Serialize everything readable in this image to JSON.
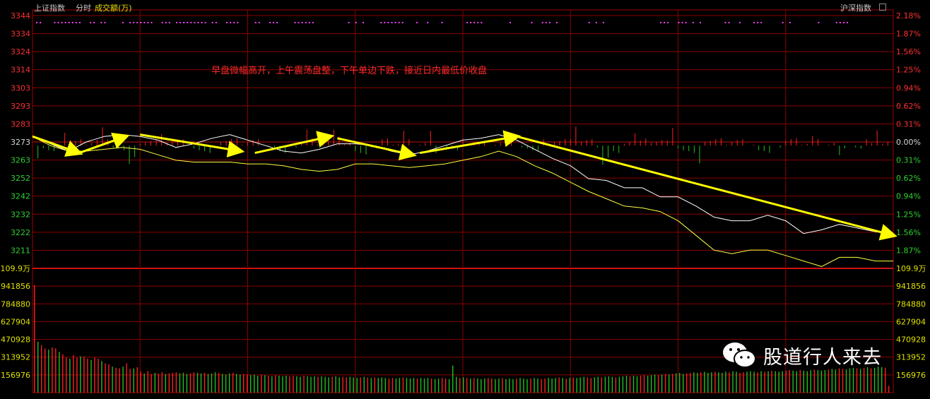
{
  "header": {
    "index_name": "上证指数",
    "period": "分时",
    "indicator": "成交额(万)",
    "right_label": "沪深指数"
  },
  "annotation": "早盘微幅高开，上午震荡盘整，下午单边下跌，接近日内最低价收盘",
  "watermark": {
    "text": "股道行人来去",
    "icon": "wechat-icon"
  },
  "colors": {
    "up": "#ff2020",
    "down": "#20c020",
    "price": "#ffffff",
    "avg": "#ffff40",
    "grid": "#8b0000",
    "arrow": "#ffff00"
  },
  "chart_data": [
    {
      "type": "line",
      "title": "",
      "y_left_ticks": [
        "3344",
        "3334",
        "3324",
        "3314",
        "3303",
        "3293",
        "3283",
        "3273",
        "3263",
        "3252",
        "3242",
        "3232",
        "3222",
        "3211"
      ],
      "y_right_ticks": [
        "2.18%",
        "1.87%",
        "1.56%",
        "1.25%",
        "0.94%",
        "0.62%",
        "0.31%",
        "0.00%",
        "0.31%",
        "0.62%",
        "0.94%",
        "1.25%",
        "1.56%",
        "1.87%"
      ],
      "ylim": [
        3206,
        3344
      ],
      "prev_close": 3273,
      "x_minutes": [
        0,
        5,
        10,
        15,
        20,
        25,
        30,
        35,
        40,
        45,
        50,
        55,
        60,
        65,
        70,
        75,
        80,
        85,
        90,
        95,
        100,
        105,
        110,
        115,
        120,
        125,
        130,
        135,
        140,
        145,
        150,
        155,
        160,
        165,
        170,
        175,
        180,
        185,
        190,
        195,
        200,
        205,
        210,
        215,
        220,
        225,
        230,
        235,
        240
      ],
      "series": [
        {
          "values": [
            3278,
            3274,
            3270,
            3275,
            3278,
            3279,
            3278,
            3276,
            3272,
            3274,
            3277,
            3279,
            3276,
            3273,
            3270,
            3269,
            3271,
            3274,
            3274,
            3273,
            3270,
            3268,
            3270,
            3273,
            3276,
            3277,
            3279,
            3276,
            3271,
            3266,
            3262,
            3255,
            3254,
            3250,
            3250,
            3245,
            3245,
            3240,
            3234,
            3232,
            3232,
            3235,
            3232,
            3225,
            3227,
            3230,
            3228,
            3226,
            3225
          ]
        },
        {
          "values": [
            3278,
            3273,
            3270,
            3270,
            3271,
            3272,
            3271,
            3268,
            3265,
            3264,
            3264,
            3264,
            3263,
            3263,
            3262,
            3260,
            3259,
            3260,
            3263,
            3263,
            3262,
            3261,
            3262,
            3263,
            3265,
            3267,
            3270,
            3267,
            3262,
            3258,
            3253,
            3248,
            3244,
            3240,
            3239,
            3237,
            3232,
            3224,
            3216,
            3214,
            3216,
            3216,
            3213,
            3210,
            3207,
            3212,
            3212,
            3210,
            3210
          ]
        }
      ],
      "trend_arrows": [
        {
          "from": [
            0,
            3278
          ],
          "to": [
            13,
            3269
          ]
        },
        {
          "from": [
            13,
            3269
          ],
          "to": [
            26,
            3278
          ]
        },
        {
          "from": [
            30,
            3279
          ],
          "to": [
            58,
            3270
          ]
        },
        {
          "from": [
            62,
            3269
          ],
          "to": [
            83,
            3278
          ]
        },
        {
          "from": [
            85,
            3277
          ],
          "to": [
            106,
            3268
          ]
        },
        {
          "from": [
            108,
            3269
          ],
          "to": [
            135,
            3278
          ]
        },
        {
          "from": [
            135,
            3278
          ],
          "to": [
            240,
            3224
          ]
        }
      ],
      "signal_dots": [
        1,
        2,
        6,
        7,
        8,
        9,
        10,
        11,
        12,
        13,
        16,
        17,
        19,
        20,
        25,
        27,
        28,
        29,
        30,
        31,
        32,
        33,
        36,
        37,
        38,
        40,
        41,
        42,
        43,
        44,
        45,
        46,
        47,
        48,
        50,
        51,
        54,
        55,
        56,
        57,
        62,
        63,
        66,
        67,
        68,
        73,
        74,
        75,
        76,
        77,
        78,
        88,
        90,
        92,
        97,
        98,
        99,
        100,
        101,
        102,
        103,
        107,
        110,
        114,
        121,
        122,
        123,
        124,
        125,
        133,
        139,
        142,
        143,
        144,
        146,
        155,
        157,
        159,
        175,
        176,
        177,
        180,
        181,
        182,
        184,
        186,
        193,
        194,
        197,
        201,
        202,
        203,
        209,
        211,
        219,
        224,
        225,
        226,
        227
      ]
    },
    {
      "type": "bar",
      "title": "成交额(万)",
      "y_ticks": [
        "109.9万",
        "941856",
        "784880",
        "627904",
        "470928",
        "313952",
        "156976"
      ],
      "ylim": [
        0,
        1098832
      ],
      "values": [
        950000,
        450000,
        420000,
        390000,
        380000,
        400000,
        390000,
        360000,
        340000,
        310000,
        300000,
        330000,
        310000,
        320000,
        320000,
        300000,
        290000,
        310000,
        300000,
        280000,
        260000,
        250000,
        230000,
        220000,
        215000,
        230000,
        260000,
        210000,
        215000,
        225000,
        185000,
        170000,
        190000,
        165000,
        175000,
        170000,
        180000,
        165000,
        170000,
        175000,
        180000,
        170000,
        175000,
        165000,
        170000,
        180000,
        175000,
        170000,
        175000,
        165000,
        170000,
        180000,
        175000,
        165000,
        160000,
        170000,
        175000,
        165000,
        160000,
        165000,
        160000,
        155000,
        160000,
        150000,
        160000,
        155000,
        150000,
        145000,
        155000,
        150000,
        145000,
        150000,
        145000,
        150000,
        145000,
        140000,
        150000,
        145000,
        140000,
        145000,
        140000,
        145000,
        140000,
        135000,
        140000,
        145000,
        135000,
        140000,
        135000,
        140000,
        135000,
        130000,
        135000,
        140000,
        135000,
        130000,
        135000,
        130000,
        135000,
        130000,
        125000,
        130000,
        125000,
        130000,
        135000,
        130000,
        125000,
        130000,
        125000,
        130000,
        125000,
        130000,
        125000,
        120000,
        125000,
        130000,
        125000,
        120000,
        240000,
        140000,
        130000,
        135000,
        130000,
        125000,
        130000,
        125000,
        120000,
        125000,
        130000,
        125000,
        120000,
        125000,
        130000,
        120000,
        125000,
        120000,
        125000,
        130000,
        125000,
        120000,
        125000,
        130000,
        125000,
        120000,
        125000,
        130000,
        125000,
        130000,
        135000,
        130000,
        125000,
        130000,
        135000,
        130000,
        135000,
        140000,
        135000,
        130000,
        135000,
        140000,
        135000,
        140000,
        145000,
        140000,
        135000,
        140000,
        145000,
        150000,
        145000,
        150000,
        145000,
        150000,
        155000,
        150000,
        155000,
        160000,
        155000,
        160000,
        165000,
        160000,
        165000,
        170000,
        175000,
        165000,
        170000,
        175000,
        180000,
        175000,
        180000,
        185000,
        175000,
        180000,
        185000,
        180000,
        175000,
        185000,
        180000,
        190000,
        185000,
        175000,
        180000,
        185000,
        190000,
        185000,
        180000,
        190000,
        185000,
        190000,
        195000,
        190000,
        185000,
        190000,
        195000,
        200000,
        195000,
        190000,
        200000,
        195000,
        190000,
        200000,
        205000,
        200000,
        195000,
        200000,
        205000,
        210000,
        205000,
        215000,
        210000,
        205000,
        215000,
        220000,
        215000,
        210000,
        220000,
        225000,
        215000,
        220000,
        230000,
        225000,
        220000,
        60000
      ]
    }
  ]
}
